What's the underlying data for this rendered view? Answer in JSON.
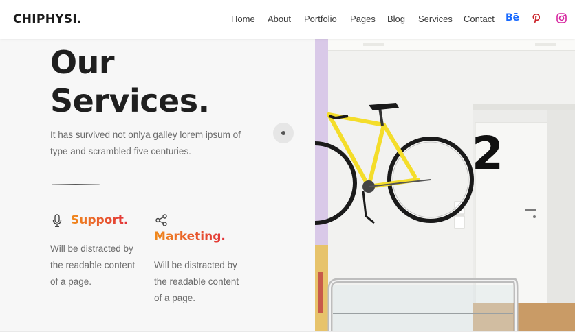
{
  "header": {
    "logo": "CHIPHYSI.",
    "nav": [
      "Home",
      "About",
      "Portfolio",
      "Pages",
      "Blog",
      "Services",
      "Contact"
    ],
    "social": [
      {
        "icon": "behance-icon",
        "label": "Bē",
        "color": "#1769ff"
      },
      {
        "icon": "pinterest-icon",
        "color": "#cb2027"
      },
      {
        "icon": "instagram-icon",
        "color": "#d6249f"
      }
    ]
  },
  "hero": {
    "title_line1": "Our",
    "title_line2": "Services.",
    "intro": "It has survived not onlya galley lorem ipsum of type and scrambled five centuries."
  },
  "services": [
    {
      "icon": "microphone-icon",
      "title": "Support.",
      "description": "Will be distracted by the readable content of a page."
    },
    {
      "icon": "share-icon",
      "title": "Marketing.",
      "description": "Will be distracted by the readable content of a page."
    }
  ],
  "photo": {
    "door_number": "2"
  },
  "colors": {
    "accent_start": "#f08a1c",
    "accent_end": "#e2323a",
    "bike_yellow": "#f4dd2a",
    "panel_bg": "#f7f7f7"
  }
}
